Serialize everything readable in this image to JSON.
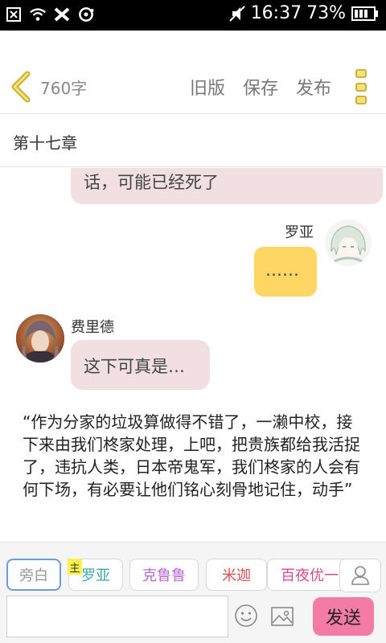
{
  "status_bar": {
    "time": "16:37",
    "battery": "73%",
    "icons": [
      "notification-close-icon",
      "wifi-icon",
      "bluetooth-icon",
      "hotspot-icon",
      "mute-icon",
      "battery-icon"
    ]
  },
  "toolbar": {
    "word_count": "760字",
    "old_version": "旧版",
    "save": "保存",
    "publish": "发布",
    "accent_color": "#c7b23a"
  },
  "chapter": {
    "title": "第十七章"
  },
  "messages": {
    "top_bubble": "话，可能已经死了",
    "luoya_name": "罗亚",
    "luoya_text": "……",
    "fei_name": "费里德",
    "fei_text": "这下可真是…",
    "narration": "“作为分家的垃圾算做得不错了，一濑中校，接下来由我们柊家处理，上吧，把贵族都给我活捉了，违抗人类，日本帝鬼军，我们柊家的人会有何下场，有必要让他们铭心刻骨地记住，动手”"
  },
  "bottom": {
    "chips": [
      {
        "label": "旁白",
        "color": "#999999"
      },
      {
        "label": "罗亚",
        "color": "#3aa6a6"
      },
      {
        "label": "克鲁鲁",
        "color": "#b46ad0"
      },
      {
        "label": "米迦",
        "color": "#e05050"
      },
      {
        "label": "百夜优一",
        "color": "#d84a8a"
      }
    ],
    "main_tag": "主",
    "input_placeholder": "",
    "send": "发送",
    "send_color": "#f57ba7"
  }
}
